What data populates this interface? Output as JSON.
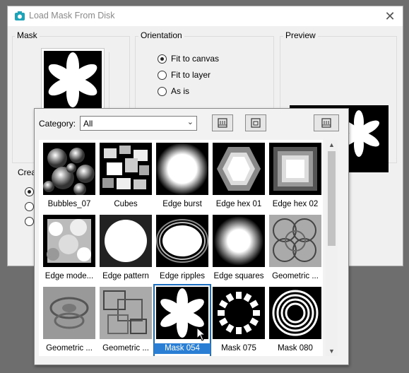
{
  "window": {
    "title": "Load Mask From Disk",
    "close_glyph": "✕"
  },
  "groups": {
    "mask": "Mask",
    "orientation": "Orientation",
    "preview": "Preview",
    "create": "Crea"
  },
  "orientation": {
    "options": [
      {
        "label": "Fit to canvas",
        "checked": true
      },
      {
        "label": "Fit to layer",
        "checked": false
      },
      {
        "label": "As is",
        "checked": false
      }
    ]
  },
  "popup": {
    "category_label": "Category:",
    "category_value": "All",
    "items": [
      {
        "label": "Bubbles_07"
      },
      {
        "label": "Cubes"
      },
      {
        "label": "Edge burst"
      },
      {
        "label": "Edge hex 01"
      },
      {
        "label": "Edge hex 02"
      },
      {
        "label": "Edge mode..."
      },
      {
        "label": "Edge pattern"
      },
      {
        "label": "Edge ripples"
      },
      {
        "label": "Edge squares"
      },
      {
        "label": "Geometric ..."
      },
      {
        "label": "Geometric ..."
      },
      {
        "label": "Geometric ..."
      },
      {
        "label": "Mask 054",
        "selected": true
      },
      {
        "label": "Mask 075"
      },
      {
        "label": "Mask 080"
      }
    ]
  },
  "colors": {
    "accent": "#2a7fd4",
    "title_icon": "#1fa3b8"
  }
}
